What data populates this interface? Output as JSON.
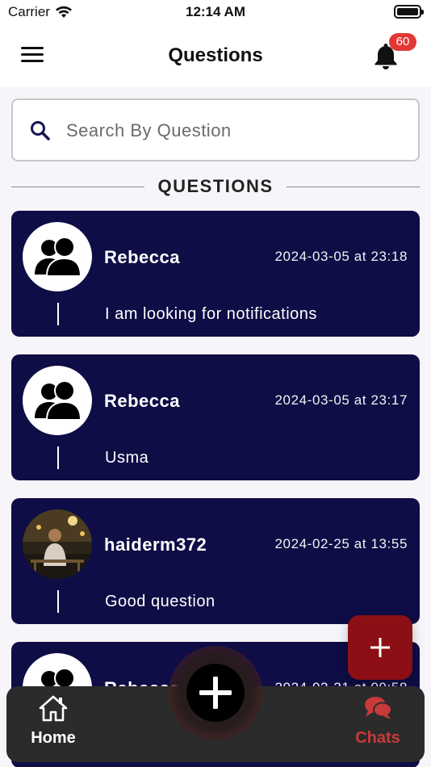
{
  "status_bar": {
    "carrier": "Carrier",
    "time": "12:14 AM"
  },
  "header": {
    "title": "Questions",
    "notification_count": "60"
  },
  "search": {
    "placeholder": "Search By Question",
    "value": ""
  },
  "section": {
    "title": "QUESTIONS"
  },
  "questions": [
    {
      "author": "Rebecca",
      "timestamp": "2024-03-05 at 23:18",
      "text": "I am looking for notifications",
      "avatar": "default-user-icon"
    },
    {
      "author": "Rebecca",
      "timestamp": "2024-03-05 at 23:17",
      "text": "Usma",
      "avatar": "default-user-icon"
    },
    {
      "author": "haiderm372",
      "timestamp": "2024-02-25 at 13:55",
      "text": "Good question",
      "avatar": "profile-photo"
    },
    {
      "author": "Rebecca",
      "timestamp": "2024-02-21 at 09:58",
      "text": "",
      "avatar": "default-user-icon"
    }
  ],
  "tabs": {
    "home_label": "Home",
    "chats_label": "Chats"
  },
  "colors": {
    "card": "#0e0d46",
    "badge": "#e33737",
    "fab": "#8b0f15",
    "tabbar": "#2b2b2b",
    "chats_accent": "#c83a3a"
  }
}
